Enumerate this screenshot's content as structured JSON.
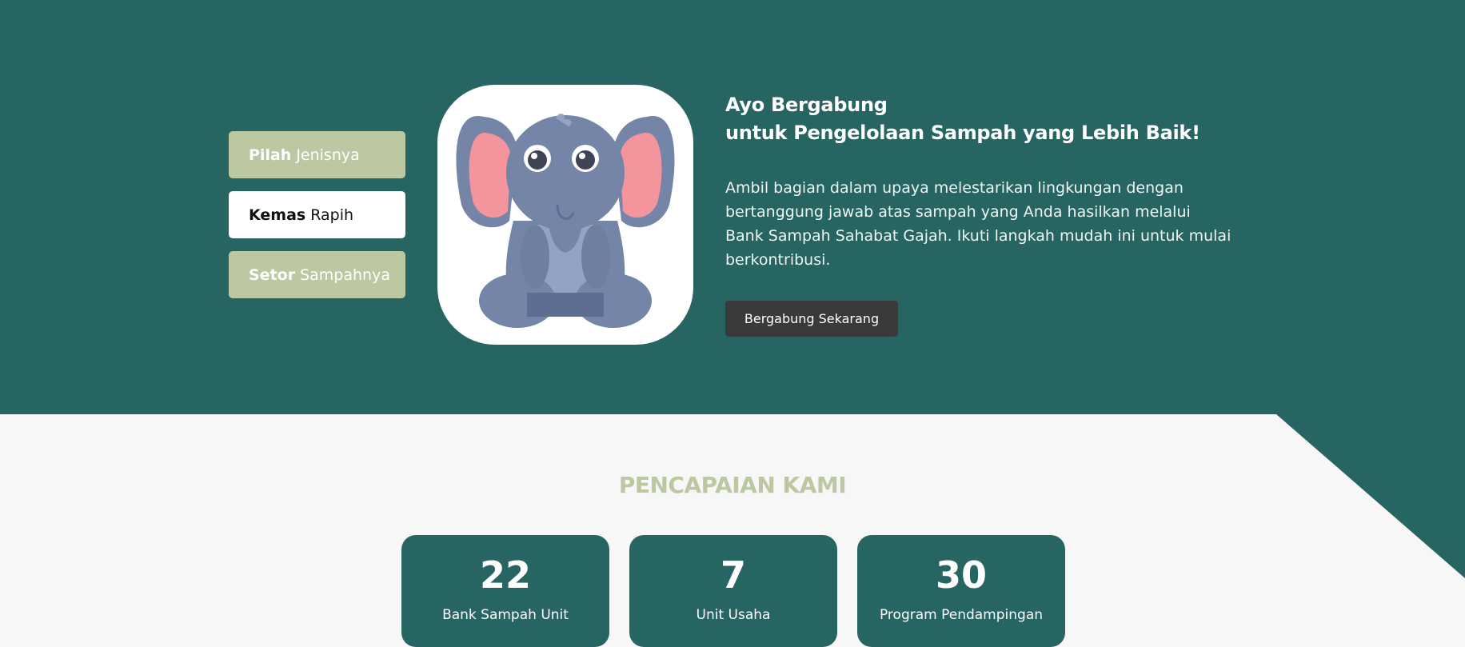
{
  "colors": {
    "primary_teal": "#276562",
    "sage_green": "#bbc8a1",
    "light_bg": "#f7f7f7",
    "button_dark": "#3a3a3a"
  },
  "steps": [
    {
      "bold": "Pilah",
      "rest": "Jenisnya",
      "style": "green"
    },
    {
      "bold": "Kemas",
      "rest": "Rapih",
      "style": "white"
    },
    {
      "bold": "Setor",
      "rest": "Sampahnya",
      "style": "green"
    }
  ],
  "mascot": {
    "icon": "elephant-mascot-illustration"
  },
  "hero": {
    "title_line1": "Ayo Bergabung",
    "title_line2": "untuk Pengelolaan Sampah yang Lebih Baik!",
    "description": "Ambil bagian dalam upaya melestarikan lingkungan dengan bertanggung jawab atas sampah yang Anda hasilkan melalui Bank Sampah Sahabat Gajah. Ikuti langkah mudah ini untuk mulai berkontribusi.",
    "cta_label": "Bergabung Sekarang"
  },
  "achievements": {
    "title": "PENCAPAIAN KAMI",
    "items": [
      {
        "number": "22",
        "label": "Bank Sampah Unit"
      },
      {
        "number": "7",
        "label": "Unit Usaha"
      },
      {
        "number": "30",
        "label": "Program Pendampingan"
      }
    ]
  }
}
